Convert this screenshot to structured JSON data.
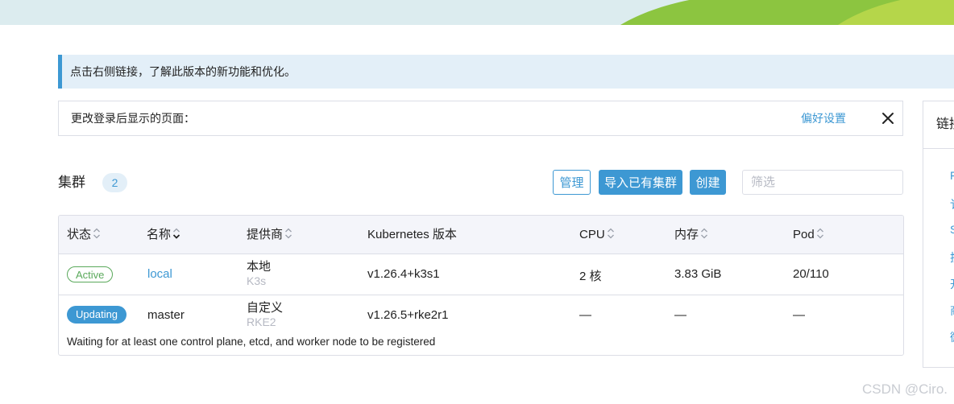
{
  "notice": {
    "text": "点击右侧链接，了解此版本的新功能和优化。"
  },
  "login_banner": {
    "label": "更改登录后显示的页面：",
    "preference_link": "偏好设置",
    "close_icon": "close-icon"
  },
  "side_card": {
    "title": "链接",
    "links": [
      "F",
      "讠",
      "S",
      "技",
      "开",
      "商",
      "微"
    ]
  },
  "clusters": {
    "title": "集群",
    "count": "2",
    "buttons": {
      "manage": "管理",
      "import": "导入已有集群",
      "create": "创建"
    },
    "filter_placeholder": "筛选",
    "columns": {
      "state": "状态",
      "name": "名称",
      "provider": "提供商",
      "k8s_version": "Kubernetes 版本",
      "cpu": "CPU",
      "memory": "内存",
      "pods": "Pod"
    },
    "rows": [
      {
        "state": "Active",
        "name": "local",
        "provider": "本地",
        "provider_sub": "K3s",
        "k8s_version": "v1.26.4+k3s1",
        "cpu": "2 核",
        "memory": "3.83 GiB",
        "pods": "20/110"
      },
      {
        "state": "Updating",
        "name": "master",
        "provider": "自定义",
        "provider_sub": "RKE2",
        "k8s_version": "v1.26.5+rke2r1",
        "cpu": "—",
        "memory": "—",
        "pods": "—",
        "message": "Waiting for at least one control plane, etcd, and worker node to be registered"
      }
    ]
  },
  "watermark": "CSDN @Ciro.",
  "colors": {
    "accent": "#3d98d3",
    "active_green": "#5aa95b",
    "banner_bg": "#dcecef",
    "banner_green": "#8cc540",
    "banner_lime": "#b5d64a"
  }
}
